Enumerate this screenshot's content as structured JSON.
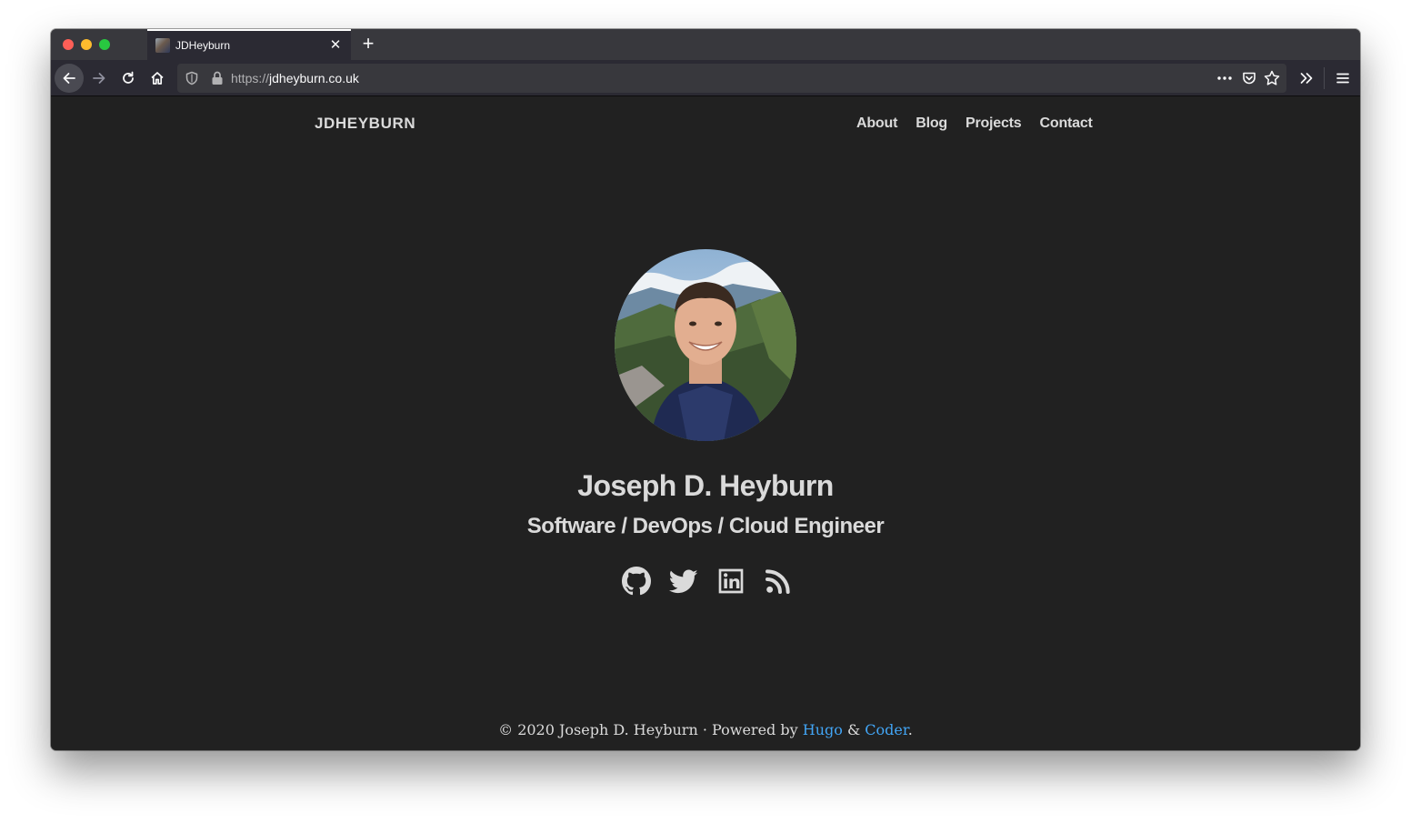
{
  "browser": {
    "tab": {
      "title": "JDHeyburn",
      "close_glyph": "✕"
    },
    "new_tab_glyph": "+",
    "url": {
      "scheme": "https://",
      "host": "jdheyburn.co.uk"
    },
    "icons": [
      "back-arrow-icon",
      "forward-arrow-icon",
      "reload-icon",
      "home-icon",
      "shield-icon",
      "lock-icon",
      "more-dots-icon",
      "pocket-icon",
      "star-icon",
      "overflow-chevron-icon",
      "hamburger-menu-icon"
    ]
  },
  "site": {
    "title": "JDHEYBURN",
    "nav": [
      "About",
      "Blog",
      "Projects",
      "Contact"
    ]
  },
  "profile": {
    "name": "Joseph D. Heyburn",
    "role": "Software / DevOps / Cloud Engineer",
    "social_icons": [
      "github-icon",
      "twitter-icon",
      "linkedin-icon",
      "rss-icon"
    ]
  },
  "footer": {
    "prefix": "© 2020 Joseph D. Heyburn · Powered by ",
    "link1": "Hugo",
    "middle": " & ",
    "link2": "Coder",
    "suffix": "."
  },
  "colors": {
    "page_background": "#212121",
    "text": "#dadada",
    "link": "#42a5f5"
  }
}
